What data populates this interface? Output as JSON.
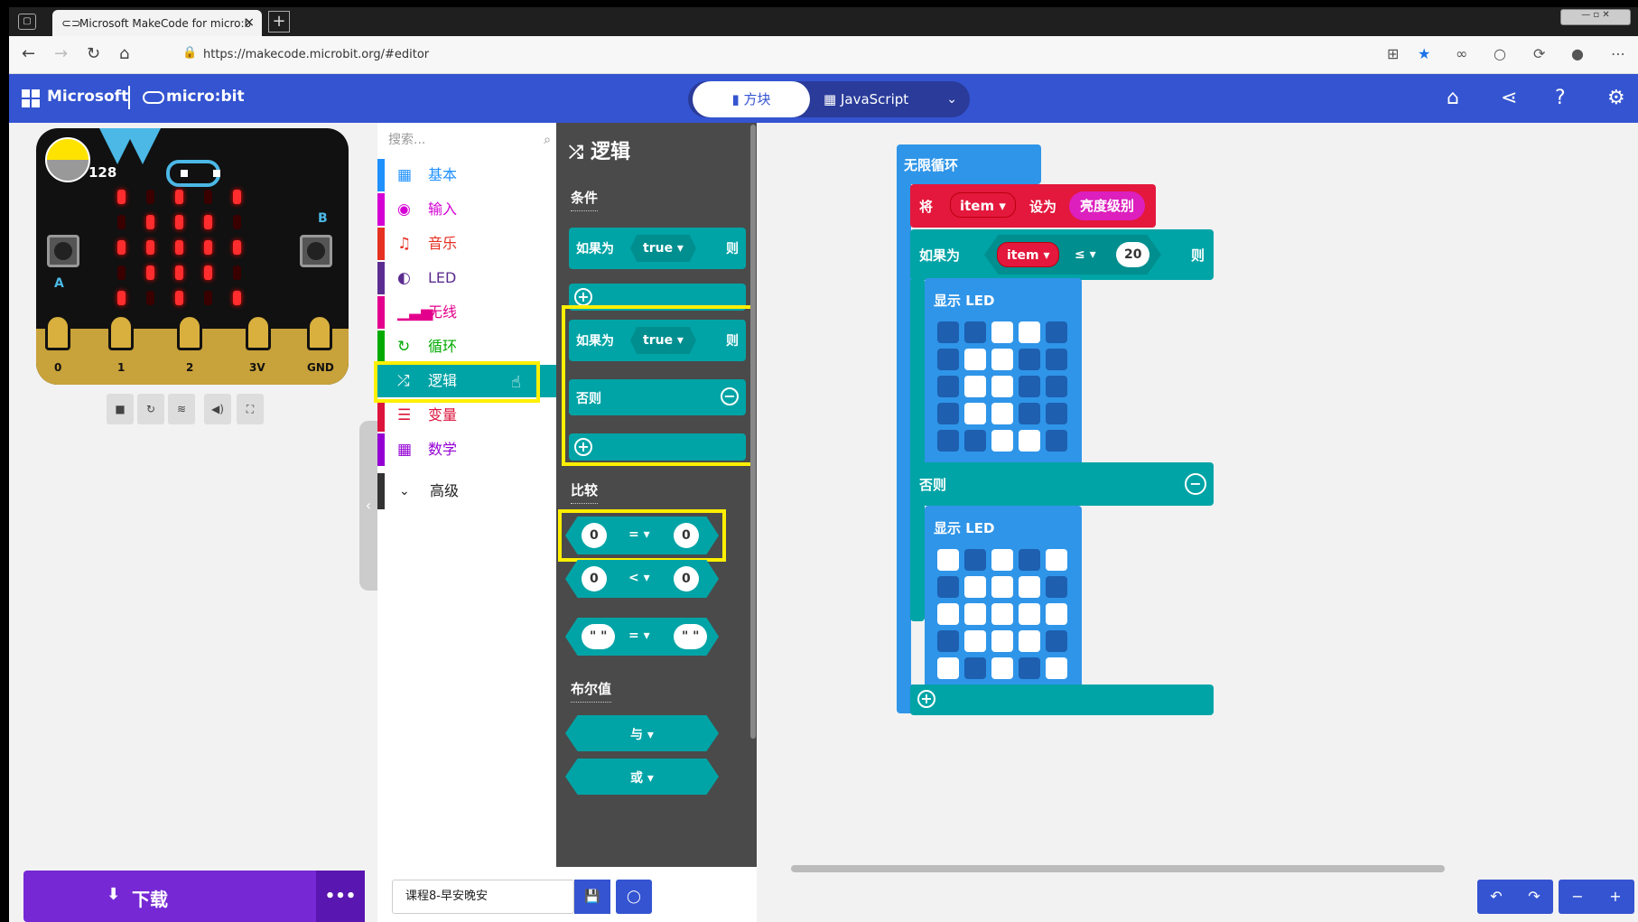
{
  "browser": {
    "tab_title": "Microsoft MakeCode for micro:b",
    "url": "https://makecode.microbit.org/#editor"
  },
  "header": {
    "ms_label": "Microsoft",
    "mb_label": "micro:bit",
    "blocks_tab": "方块",
    "js_tab": "JavaScript"
  },
  "sim": {
    "light_level": "128",
    "pins": [
      "0",
      "1",
      "2",
      "3V",
      "GND"
    ],
    "btn_a": "A",
    "btn_b": "B"
  },
  "toolbox": {
    "search_placeholder": "搜索...",
    "categories": [
      {
        "label": "基本",
        "color": "#1e90ff"
      },
      {
        "label": "输入",
        "color": "#d400d4"
      },
      {
        "label": "音乐",
        "color": "#e63022"
      },
      {
        "label": "LED",
        "color": "#5c2d91"
      },
      {
        "label": "无线",
        "color": "#e3008c"
      },
      {
        "label": "循环",
        "color": "#00aa00"
      },
      {
        "label": "逻辑",
        "color": "#00a4a6"
      },
      {
        "label": "变量",
        "color": "#dc143c"
      },
      {
        "label": "数学",
        "color": "#9400d3"
      }
    ],
    "advanced": "高级"
  },
  "flyout": {
    "title": "逻辑",
    "sec_conditions": "条件",
    "sec_compare": "比较",
    "sec_boolean": "布尔值",
    "if_label": "如果为",
    "then_label": "则",
    "else_label": "否则",
    "true_val": "true",
    "zero": "0",
    "eq": "=",
    "lt": "<",
    "empty_str": "\" \"",
    "and_label": "与",
    "or_label": "或"
  },
  "workspace": {
    "forever": "无限循环",
    "set_label": "将",
    "var": "item",
    "set_to": "设为",
    "brightness": "亮度级别",
    "if_label": "如果为",
    "op": "≤",
    "num": "20",
    "then_label": "则",
    "show_led": "显示 LED",
    "else_label": "否则",
    "led1": [
      0,
      0,
      1,
      1,
      0,
      0,
      1,
      1,
      0,
      0,
      0,
      1,
      1,
      0,
      0,
      0,
      1,
      1,
      0,
      0,
      0,
      0,
      1,
      1,
      0
    ],
    "led2": [
      1,
      0,
      1,
      0,
      1,
      0,
      1,
      1,
      1,
      0,
      1,
      1,
      1,
      1,
      1,
      0,
      1,
      1,
      1,
      0,
      1,
      0,
      1,
      0,
      1
    ]
  },
  "bottom": {
    "download": "下载",
    "project_name": "课程8-早安晚安"
  }
}
